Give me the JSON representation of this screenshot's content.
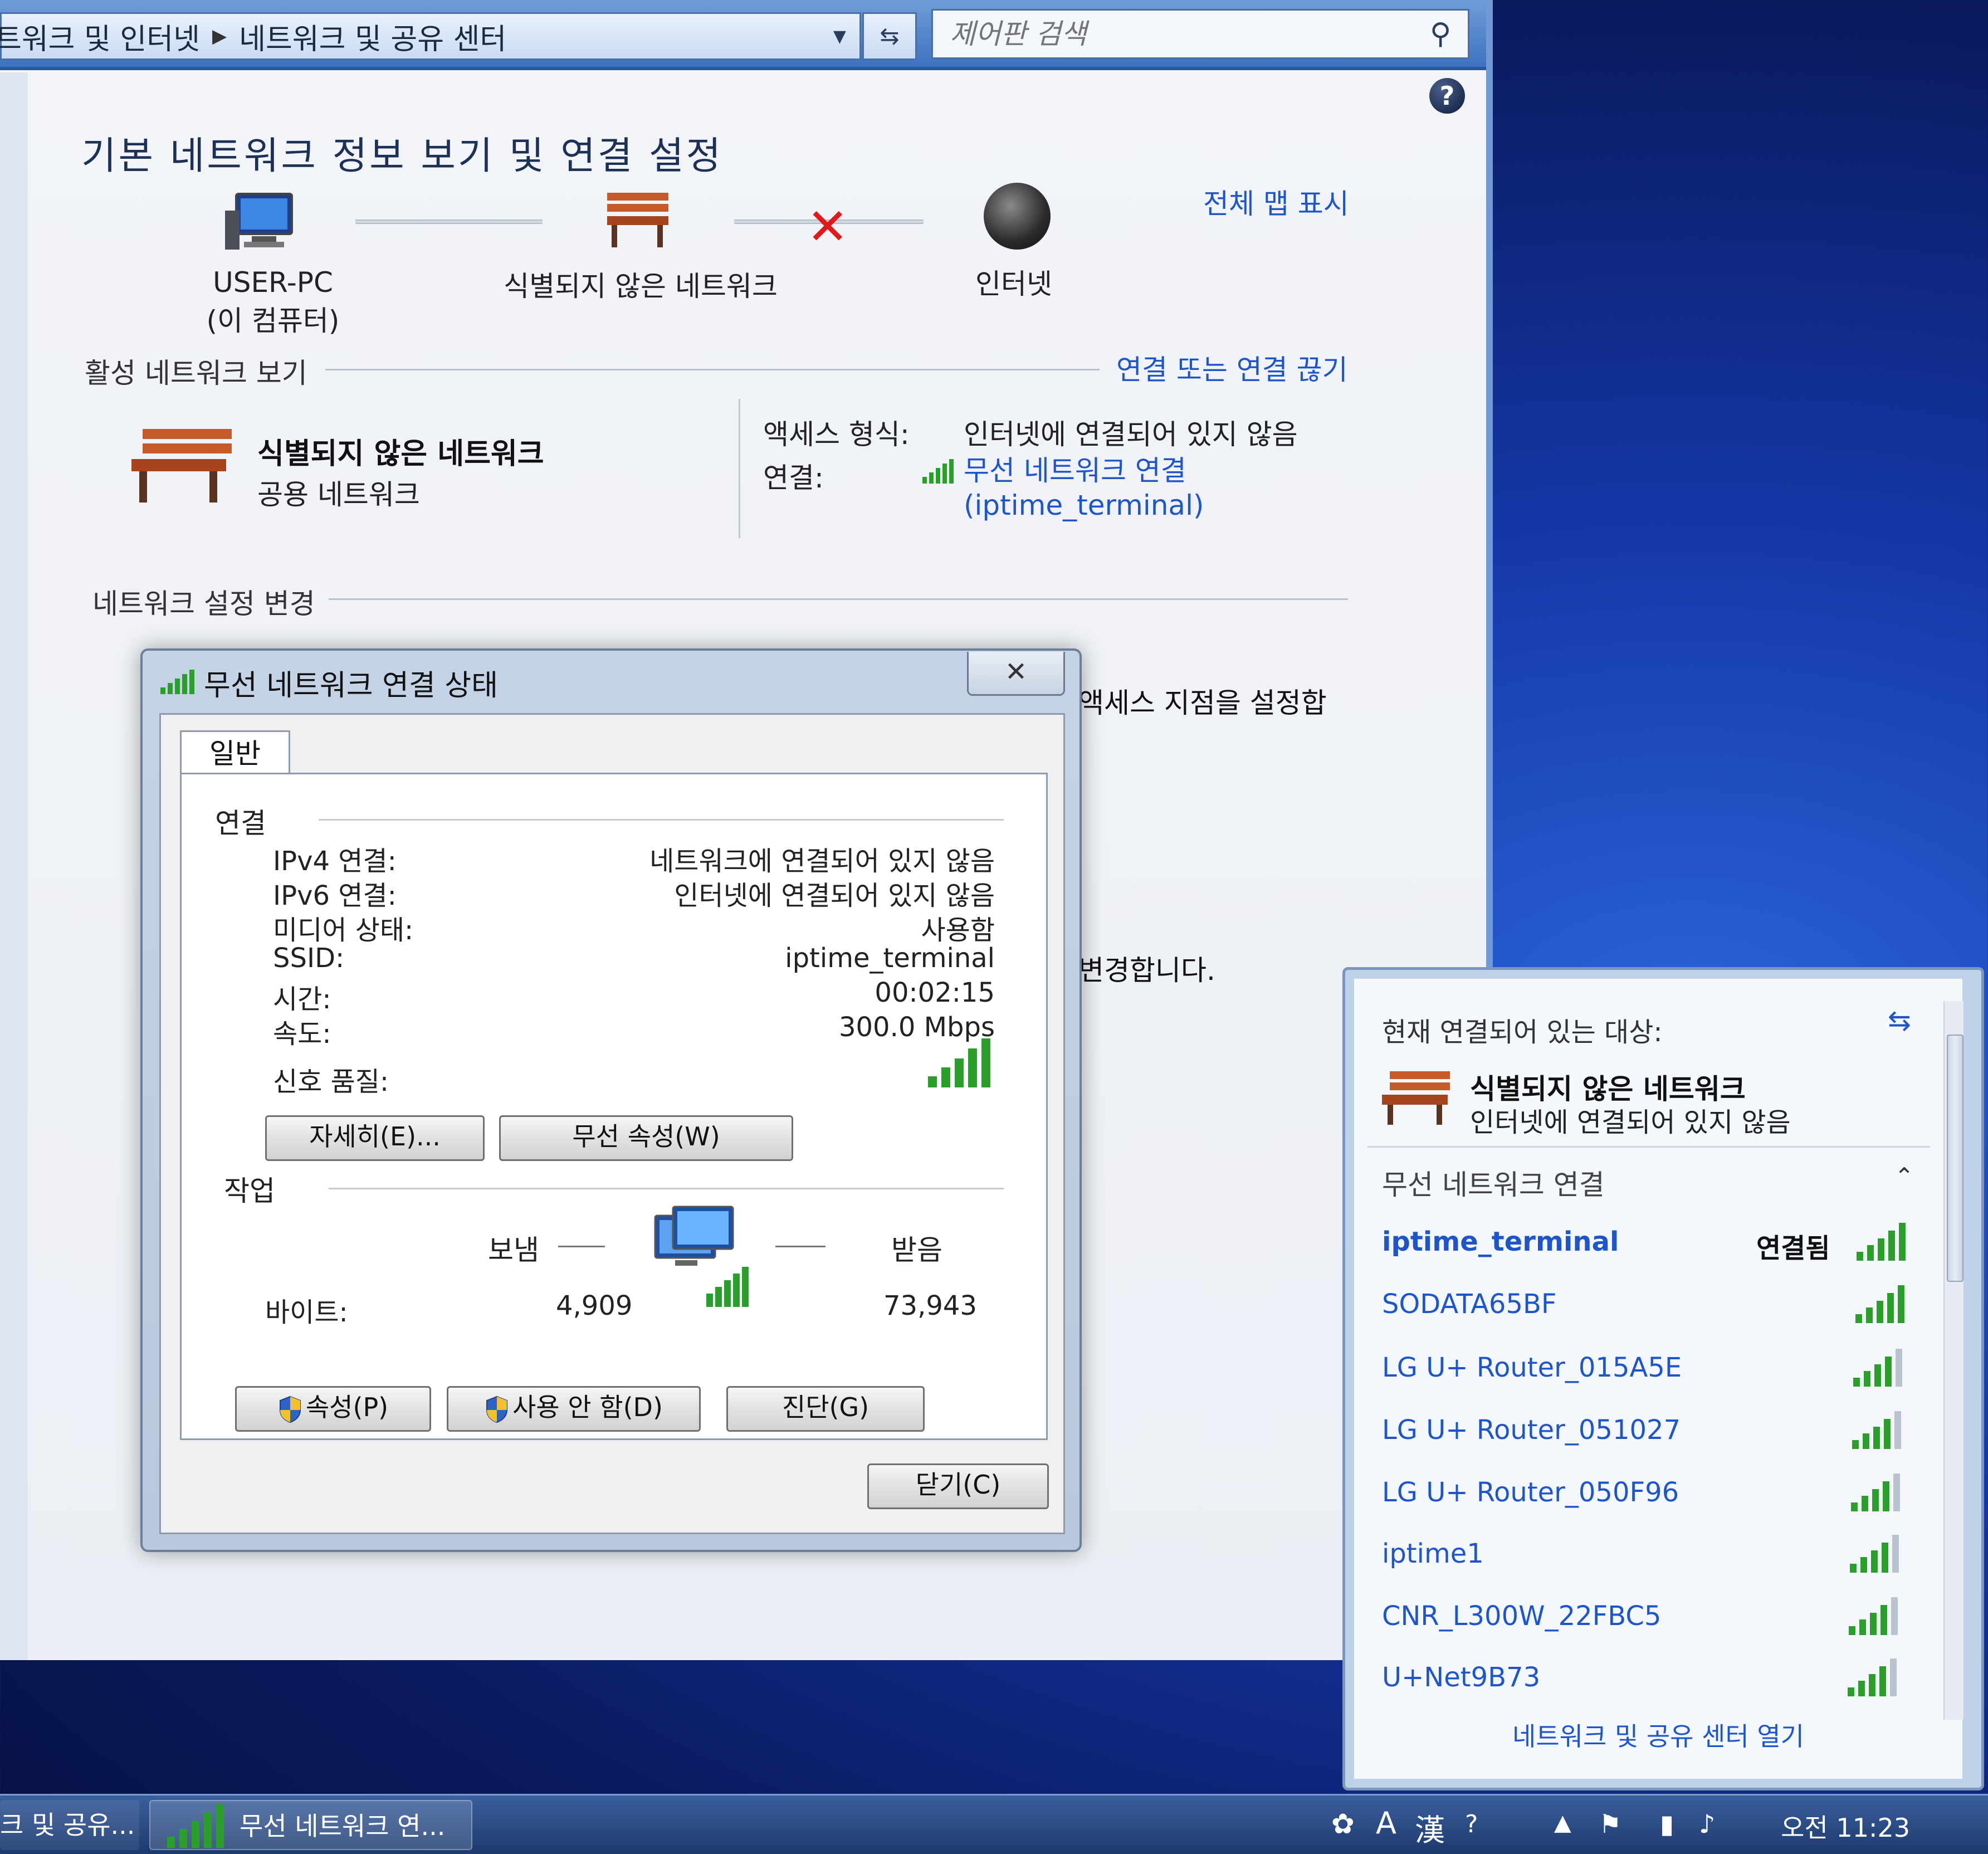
{
  "window": {
    "breadcrumb": [
      "트워크 및 인터넷",
      "네트워크 및 공유 센터"
    ],
    "search_placeholder": "제어판 검색",
    "help": "?"
  },
  "main": {
    "title": "기본 네트워크 정보 보기 및 연결 설정",
    "full_map_link": "전체 맵 표시",
    "map": {
      "pc_name": "USER-PC",
      "pc_sub": "(이 컴퓨터)",
      "network": "식별되지 않은 네트워크",
      "internet": "인터넷"
    },
    "active_section": "활성 네트워크 보기",
    "connect_link": "연결 또는 연결 끊기",
    "active_network": {
      "name": "식별되지 않은 네트워크",
      "type": "공용 네트워크",
      "access_label": "액세스 형식:",
      "access_value": "인터넷에 연결되어 있지 않음",
      "conn_label": "연결:",
      "conn_value_1": "무선 네트워크 연결",
      "conn_value_2": "(iptime_terminal)"
    },
    "settings_section": "네트워크 설정 변경",
    "partial_text_1": "액세스 지점을 설정합",
    "partial_text_2": "변경합니다."
  },
  "dialog": {
    "title": "무선 네트워크 연결 상태",
    "close": "✕",
    "tab_general": "일반",
    "group_connection": "연결",
    "rows": [
      {
        "label": "IPv4 연결:",
        "value": "네트워크에 연결되어 있지 않음"
      },
      {
        "label": "IPv6 연결:",
        "value": "인터넷에 연결되어 있지 않음"
      },
      {
        "label": "미디어 상태:",
        "value": "사용함"
      },
      {
        "label": "SSID:",
        "value": "iptime_terminal"
      },
      {
        "label": "시간:",
        "value": "00:02:15"
      },
      {
        "label": "속도:",
        "value": "300.0 Mbps"
      }
    ],
    "signal_label": "신호 품질:",
    "signal_bars": 5,
    "btn_details": "자세히(E)...",
    "btn_wireless_props": "무선 속성(W)",
    "group_activity": "작업",
    "sent_label": "보냄",
    "received_label": "받음",
    "bytes_label": "바이트:",
    "bytes_sent": "4,909",
    "bytes_received": "73,943",
    "btn_properties": "속성(P)",
    "btn_disable": "사용 안 함(D)",
    "btn_diagnose": "진단(G)",
    "btn_close": "닫기(C)"
  },
  "flyout": {
    "current_label": "현재 연결되어 있는 대상:",
    "current_network": "식별되지 않은 네트워크",
    "current_status": "인터넷에 연결되어 있지 않음",
    "section": "무선 네트워크 연결",
    "networks": [
      {
        "ssid": "iptime_terminal",
        "status": "연결됨",
        "bars": 5
      },
      {
        "ssid": "SODATA65BF",
        "status": "",
        "bars": 5
      },
      {
        "ssid": "LG U+ Router_015A5E",
        "status": "",
        "bars": 4
      },
      {
        "ssid": "LG U+ Router_051027",
        "status": "",
        "bars": 4
      },
      {
        "ssid": "LG U+ Router_050F96",
        "status": "",
        "bars": 4
      },
      {
        "ssid": "iptime1",
        "status": "",
        "bars": 4
      },
      {
        "ssid": "CNR_L300W_22FBC5",
        "status": "",
        "bars": 4
      },
      {
        "ssid": "U+Net9B73",
        "status": "",
        "bars": 4
      }
    ],
    "footer_link": "네트워크 및 공유 센터 열기"
  },
  "taskbar": {
    "item1": "크 및 공유...",
    "item2": "무선 네트워크 연...",
    "ime_a": "A",
    "ime_han": "漢",
    "clock": "오전 11:23"
  },
  "colors": {
    "link": "#1e55c8",
    "error_x": "#e01a1a",
    "signal_green": "#2aa02a"
  }
}
